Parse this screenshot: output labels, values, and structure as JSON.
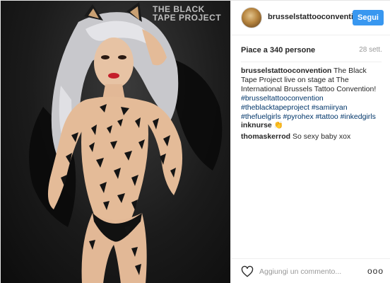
{
  "photo": {
    "watermark_lines": [
      "THE BLACK",
      "TAPE PROJECT"
    ]
  },
  "header": {
    "username": "brusselstattooconvention",
    "follow_label": "Segui"
  },
  "stats": {
    "likes": "Piace a 340 persone",
    "date": "28 sett."
  },
  "caption": {
    "user": "brusselstattooconvention",
    "text": "The Black Tape Project live on stage at The International Brussels Tattoo Convention!",
    "hashtags": "#brusseltattooconvention #theblacktapeproject #samiiryan #thefuelgirls #pyrohex #tattoo #inkedgirls"
  },
  "comments": [
    {
      "user": "inknurse",
      "text": "👏"
    },
    {
      "user": "thomaskerrod",
      "text": "So sexy baby xox"
    }
  ],
  "footer": {
    "comment_placeholder": "Aggiungi un commento...",
    "more_label": "ooo"
  },
  "colors": {
    "follow_button": "#3897f0",
    "hashtag": "#003569",
    "muted_text": "#999999"
  },
  "icons": {
    "like": "heart-outline-icon",
    "more": "more-options-icon"
  }
}
